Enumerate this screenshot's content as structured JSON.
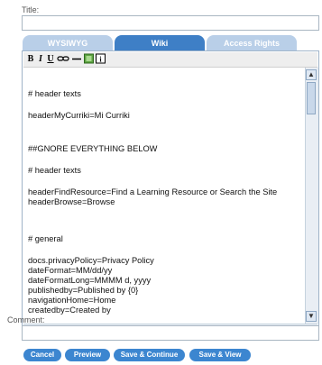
{
  "form": {
    "title_label": "Title:",
    "title_value": "",
    "comment_label": "Comment:",
    "comment_value": ""
  },
  "tabs": [
    {
      "label": "WYSIWYG",
      "active": false
    },
    {
      "label": "Wiki",
      "active": true
    },
    {
      "label": "Access Rights",
      "active": false
    }
  ],
  "toolbar": {
    "bold": "B",
    "italic": "I",
    "underline": "U"
  },
  "editor": {
    "lines": [
      "",
      "# header texts",
      "",
      "headerMyCurriki=Mi Curriki",
      "",
      "",
      "##GNORE EVERYTHING BELOW",
      "",
      "# header texts",
      "",
      "headerFindResource=Find a Learning Resource or Search the Site",
      "headerBrowse=Browse",
      "",
      "",
      "# general",
      "",
      "docs.privacyPolicy=Privacy Policy",
      "dateFormat=MM/dd/yy",
      "dateFormatLong=MMMM d, yyyy",
      "publishedby=Published by {0}",
      "navigationHome=Home",
      "createdby=Created by"
    ]
  },
  "buttons": {
    "cancel": "Cancel",
    "preview": "Preview",
    "save_continue": "Save & Continue",
    "save_view": "Save & View"
  }
}
